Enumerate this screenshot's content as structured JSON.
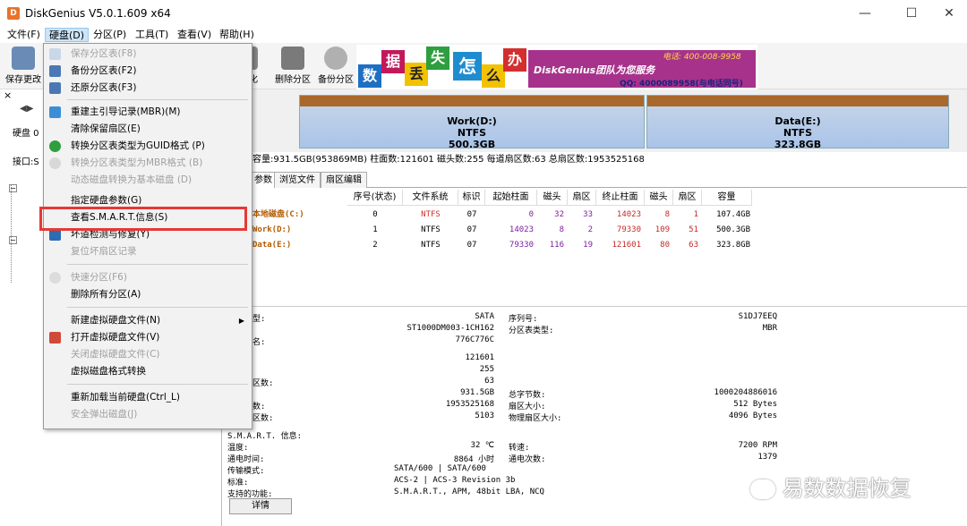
{
  "window": {
    "title": "DiskGenius V5.0.1.609 x64",
    "minimize": "—",
    "maximize": "☐",
    "close": "✕"
  },
  "menubar": [
    "文件(F)",
    "硬盘(D)",
    "分区(P)",
    "工具(T)",
    "查看(V)",
    "帮助(H)"
  ],
  "toolbar": {
    "save": "保存更改",
    "b1": "删除分区",
    "b2": "备份分区",
    "partial": "化"
  },
  "banner": {
    "chars": [
      "数",
      "据",
      "丢",
      "失",
      "怎",
      "么",
      "办"
    ],
    "slogan": "DiskGenius团队为您服务",
    "tel": "电话: 400-008-9958",
    "qq": "QQ: 4000089958(与电话同号)"
  },
  "dropdown": {
    "items": [
      {
        "label": "保存分区表(F8)",
        "disabled": true
      },
      {
        "label": "备份分区表(F2)",
        "disabled": false
      },
      {
        "label": "还原分区表(F3)",
        "disabled": false
      },
      {
        "label": "重建主引导记录(MBR)(M)",
        "disabled": false
      },
      {
        "label": "清除保留扇区(E)",
        "disabled": false
      },
      {
        "label": "转换分区表类型为GUID格式 (P)",
        "disabled": false
      },
      {
        "label": "转换分区表类型为MBR格式 (B)",
        "disabled": true
      },
      {
        "label": "动态磁盘转换为基本磁盘 (D)",
        "disabled": true
      },
      {
        "label": "指定硬盘参数(G)",
        "disabled": false
      },
      {
        "label": "查看S.M.A.R.T.信息(S)",
        "disabled": false
      },
      {
        "label": "坏道检测与修复(Y)",
        "disabled": false
      },
      {
        "label": "复位坏扇区记录",
        "disabled": true
      },
      {
        "label": "快速分区(F6)",
        "disabled": true
      },
      {
        "label": "删除所有分区(A)",
        "disabled": false
      },
      {
        "label": "新建虚拟硬盘文件(N)",
        "disabled": false
      },
      {
        "label": "打开虚拟硬盘文件(V)",
        "disabled": false
      },
      {
        "label": "关闭虚拟硬盘文件(C)",
        "disabled": true
      },
      {
        "label": "虚拟磁盘格式转换",
        "disabled": false
      },
      {
        "label": "重新加载当前硬盘(Ctrl_L)",
        "disabled": false
      },
      {
        "label": "安全弹出磁盘(J)",
        "disabled": true
      }
    ]
  },
  "left": {
    "disk_label": "硬盘 0",
    "iface_label": "接口:S",
    "x": "×"
  },
  "partitions": [
    {
      "name": "Work(D:)",
      "fs": "NTFS",
      "size": "500.3GB"
    },
    {
      "name": "Data(E:)",
      "fs": "NTFS",
      "size": "323.8GB"
    }
  ],
  "infoline": "容量:931.5GB(953869MB)    柱面数:121601    磁头数:255    每道扇区数:63    总扇区数:1953525168",
  "tabs": [
    "参数",
    "浏览文件",
    "扇区编辑"
  ],
  "table": {
    "headers": [
      "序号(状态)",
      "文件系统",
      "标识",
      "起始柱面",
      "磁头",
      "扇区",
      "终止柱面",
      "磁头",
      "扇区",
      "容量"
    ],
    "rows": [
      {
        "name": "本地磁盘(C:)",
        "cells": [
          "0",
          "NTFS",
          "07",
          "0",
          "32",
          "33",
          "14023",
          "8",
          "1",
          "107.4GB"
        ]
      },
      {
        "name": "Work(D:)",
        "cells": [
          "1",
          "NTFS",
          "07",
          "14023",
          "8",
          "2",
          "79330",
          "109",
          "51",
          "500.3GB"
        ]
      },
      {
        "name": "Data(E:)",
        "cells": [
          "2",
          "NTFS",
          "07",
          "79330",
          "116",
          "19",
          "121601",
          "80",
          "63",
          "323.8GB"
        ]
      }
    ]
  },
  "details": {
    "left_labels": [
      "型:",
      "名:"
    ],
    "iface": "SATA",
    "model": "ST1000DM003-1CH162",
    "serial_left": "776C776C",
    "serial_label": "序列号:",
    "serial": "S1DJ7EEQ",
    "ptype_label": "分区表类型:",
    "ptype": "MBR",
    "cyl": "121601",
    "heads": "255",
    "sectors_label": "区数:",
    "sectors": "63",
    "capacity": "931.5GB",
    "total_bytes_label": "总字节数:",
    "total_bytes": "1000204886016",
    "total_sectors_label": "数:",
    "total_sectors": "1953525168",
    "sector_size_label": "扇区大小:",
    "sector_size": "512 Bytes",
    "reserved_label": "区数:",
    "reserved": "5103",
    "phys_label": "物理扇区大小:",
    "phys": "4096 Bytes",
    "smart_title": "S.M.A.R.T. 信息:",
    "temp_label": "温度:",
    "temp": "32 ℃",
    "rpm_label": "转速:",
    "rpm": "7200 RPM",
    "hours_label": "通电时间:",
    "hours": "8864 小时",
    "count_label": "通电次数:",
    "count": "1379",
    "mode_label": "传输模式:",
    "mode": "SATA/600 | SATA/600",
    "std_label": "标准:",
    "std": "ACS-2 | ACS-3 Revision 3b",
    "feat_label": "支持的功能:",
    "feat": "S.M.A.R.T., APM, 48bit LBA, NCQ",
    "detail_button": "详情"
  },
  "watermark": "易数数据恢复",
  "colors": {
    "highlight": "#e53935",
    "menu_active": "#cce4f7",
    "part_top": "#a9692c"
  }
}
